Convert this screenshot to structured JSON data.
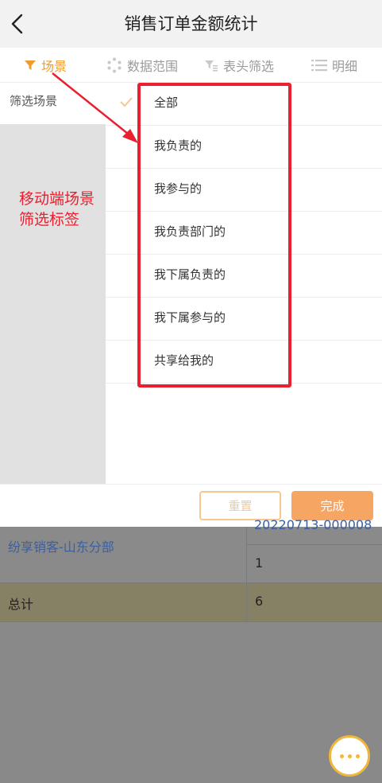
{
  "header": {
    "title": "销售订单金额统计",
    "back_icon": "chevron-left-icon"
  },
  "tabs": [
    {
      "label": "场景",
      "icon": "filter-icon",
      "active": true
    },
    {
      "label": "数据范围",
      "icon": "range-icon",
      "active": false
    },
    {
      "label": "表头筛选",
      "icon": "header-filter-icon",
      "active": false
    },
    {
      "label": "明细",
      "icon": "list-icon",
      "active": false
    }
  ],
  "left_panel": {
    "items": [
      {
        "label": "筛选场景"
      }
    ]
  },
  "options": [
    {
      "label": "全部",
      "selected": true
    },
    {
      "label": "我负责的",
      "selected": false
    },
    {
      "label": "我参与的",
      "selected": false
    },
    {
      "label": "我负责部门的",
      "selected": false
    },
    {
      "label": "我下属负责的",
      "selected": false
    },
    {
      "label": "我下属参与的",
      "selected": false
    },
    {
      "label": "共享给我的",
      "selected": false
    }
  ],
  "annotation": {
    "line1": "移动端场景",
    "line2": "筛选标签"
  },
  "actions": {
    "reset": "重置",
    "done": "完成"
  },
  "table": {
    "partial_number": "20220713-000008",
    "row_name": "纷享销客-山东分部",
    "row_value": "1",
    "total_label": "总计",
    "total_value": "6"
  },
  "colors": {
    "accent": "#f09b2a",
    "highlight": "#e8202f",
    "done": "#f6a662"
  }
}
